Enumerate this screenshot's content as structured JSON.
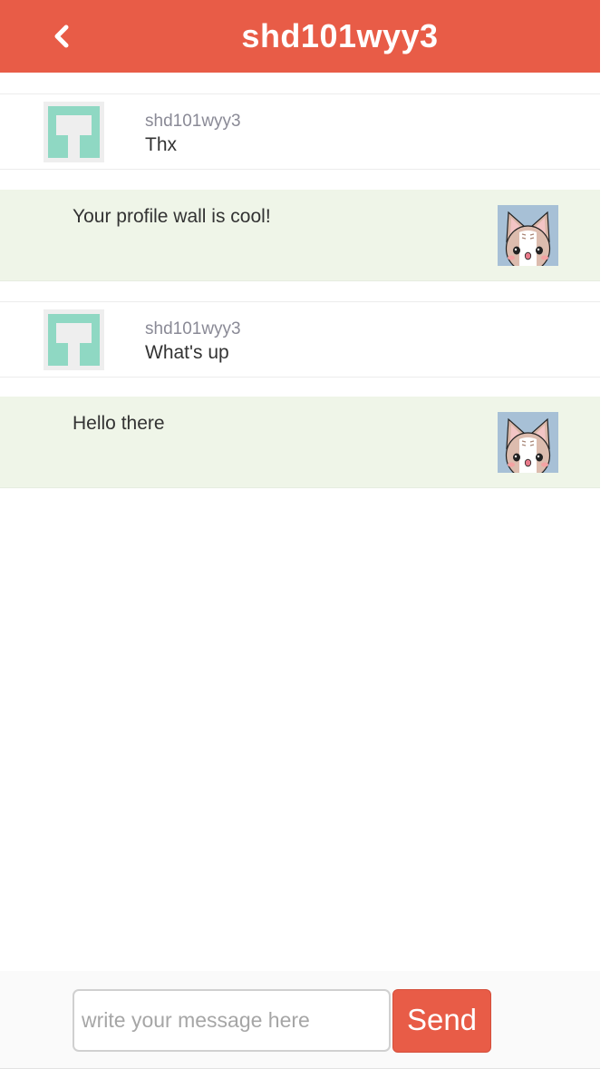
{
  "header": {
    "title": "shd101wyy3",
    "back_icon": "chevron-left-icon",
    "background_color": "#e85c47"
  },
  "messages": [
    {
      "direction": "incoming",
      "sender": "shd101wyy3",
      "text": "Thx",
      "avatar": "identicon-avatar"
    },
    {
      "direction": "outgoing",
      "text": "Your profile wall is cool!",
      "avatar": "cat-avatar"
    },
    {
      "direction": "incoming",
      "sender": "shd101wyy3",
      "text": "What's up",
      "avatar": "identicon-avatar"
    },
    {
      "direction": "outgoing",
      "text": "Hello there",
      "avatar": "cat-avatar"
    }
  ],
  "composer": {
    "placeholder": "write your message here",
    "value": "",
    "send_label": "Send",
    "send_color": "#e85c47"
  },
  "colors": {
    "accent": "#e85c47",
    "outgoing_bubble": "#eff5e8",
    "identicon": "#8fd8c3"
  }
}
